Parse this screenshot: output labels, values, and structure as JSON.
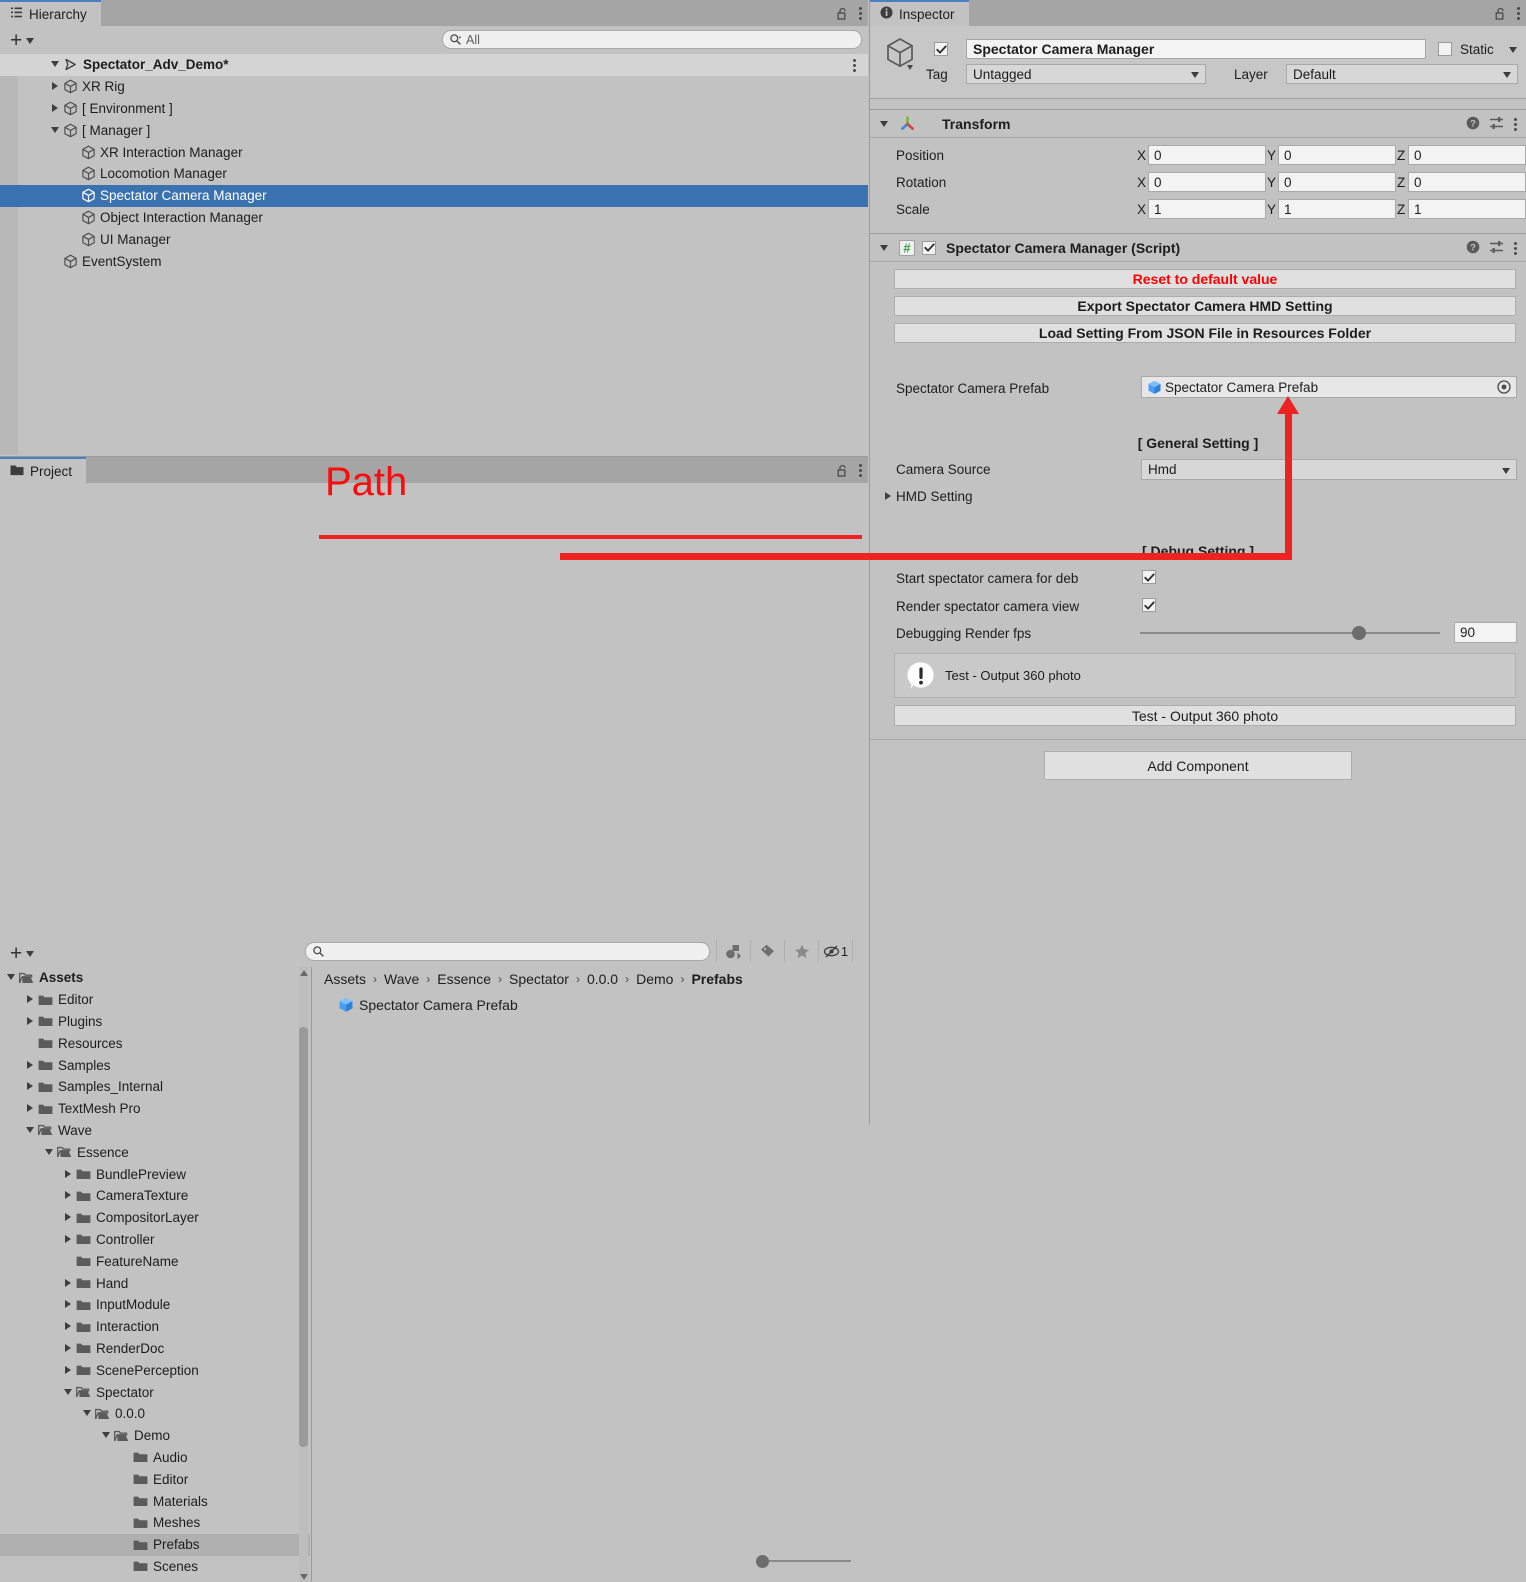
{
  "hierarchy": {
    "tab_label": "Hierarchy",
    "tab_icon": "hierarchy-icon",
    "add_button": "+",
    "search": {
      "placeholder": "All",
      "value": "",
      "icon": "search-icon"
    },
    "lock_icon": "lock-open-icon",
    "menu_icon": "kebab-menu-icon",
    "scene_name": "Spectator_Adv_Demo*",
    "items": [
      {
        "label": "XR Rig",
        "depth": 1,
        "foldout": "collapsed",
        "selected": false
      },
      {
        "label": "[ Environment ]",
        "depth": 1,
        "foldout": "collapsed",
        "selected": false
      },
      {
        "label": "[ Manager ]",
        "depth": 1,
        "foldout": "expanded",
        "selected": false
      },
      {
        "label": "XR Interaction Manager",
        "depth": 2,
        "foldout": "none",
        "selected": false
      },
      {
        "label": "Locomotion Manager",
        "depth": 2,
        "foldout": "none",
        "selected": false
      },
      {
        "label": "Spectator Camera Manager",
        "depth": 2,
        "foldout": "none",
        "selected": true
      },
      {
        "label": "Object Interaction Manager",
        "depth": 2,
        "foldout": "none",
        "selected": false
      },
      {
        "label": "UI Manager",
        "depth": 2,
        "foldout": "none",
        "selected": false
      },
      {
        "label": "EventSystem",
        "depth": 1,
        "foldout": "none",
        "selected": false
      }
    ]
  },
  "project": {
    "tab_label": "Project",
    "tab_icon": "folder-icon",
    "add_button": "+",
    "search": {
      "placeholder": "",
      "value": "",
      "icon": "search-icon"
    },
    "lock_icon": "lock-open-icon",
    "menu_icon": "kebab-menu-icon",
    "tools": [
      {
        "name": "asset-type-filter-icon",
        "label": ""
      },
      {
        "name": "label-filter-icon",
        "label": ""
      },
      {
        "name": "favorites-star-icon",
        "label": ""
      },
      {
        "name": "hidden-packages-icon",
        "label": "1"
      }
    ],
    "tree": [
      {
        "label": "Assets",
        "depth": 0,
        "foldout": "expanded",
        "open_folder": true,
        "bold": true,
        "selected": false
      },
      {
        "label": "Editor",
        "depth": 1,
        "foldout": "collapsed",
        "open_folder": false,
        "bold": false,
        "selected": false
      },
      {
        "label": "Plugins",
        "depth": 1,
        "foldout": "collapsed",
        "open_folder": false,
        "bold": false,
        "selected": false
      },
      {
        "label": "Resources",
        "depth": 1,
        "foldout": "none",
        "open_folder": false,
        "bold": false,
        "selected": false
      },
      {
        "label": "Samples",
        "depth": 1,
        "foldout": "collapsed",
        "open_folder": false,
        "bold": false,
        "selected": false
      },
      {
        "label": "Samples_Internal",
        "depth": 1,
        "foldout": "collapsed",
        "open_folder": false,
        "bold": false,
        "selected": false
      },
      {
        "label": "TextMesh Pro",
        "depth": 1,
        "foldout": "collapsed",
        "open_folder": false,
        "bold": false,
        "selected": false
      },
      {
        "label": "Wave",
        "depth": 1,
        "foldout": "expanded",
        "open_folder": true,
        "bold": false,
        "selected": false
      },
      {
        "label": "Essence",
        "depth": 2,
        "foldout": "expanded",
        "open_folder": true,
        "bold": false,
        "selected": false
      },
      {
        "label": "BundlePreview",
        "depth": 3,
        "foldout": "collapsed",
        "open_folder": false,
        "bold": false,
        "selected": false
      },
      {
        "label": "CameraTexture",
        "depth": 3,
        "foldout": "collapsed",
        "open_folder": false,
        "bold": false,
        "selected": false
      },
      {
        "label": "CompositorLayer",
        "depth": 3,
        "foldout": "collapsed",
        "open_folder": false,
        "bold": false,
        "selected": false
      },
      {
        "label": "Controller",
        "depth": 3,
        "foldout": "collapsed",
        "open_folder": false,
        "bold": false,
        "selected": false
      },
      {
        "label": "FeatureName",
        "depth": 3,
        "foldout": "none",
        "open_folder": false,
        "bold": false,
        "selected": false
      },
      {
        "label": "Hand",
        "depth": 3,
        "foldout": "collapsed",
        "open_folder": false,
        "bold": false,
        "selected": false
      },
      {
        "label": "InputModule",
        "depth": 3,
        "foldout": "collapsed",
        "open_folder": false,
        "bold": false,
        "selected": false
      },
      {
        "label": "Interaction",
        "depth": 3,
        "foldout": "collapsed",
        "open_folder": false,
        "bold": false,
        "selected": false
      },
      {
        "label": "RenderDoc",
        "depth": 3,
        "foldout": "collapsed",
        "open_folder": false,
        "bold": false,
        "selected": false
      },
      {
        "label": "ScenePerception",
        "depth": 3,
        "foldout": "collapsed",
        "open_folder": false,
        "bold": false,
        "selected": false
      },
      {
        "label": "Spectator",
        "depth": 3,
        "foldout": "expanded",
        "open_folder": true,
        "bold": false,
        "selected": false
      },
      {
        "label": "0.0.0",
        "depth": 4,
        "foldout": "expanded",
        "open_folder": true,
        "bold": false,
        "selected": false
      },
      {
        "label": "Demo",
        "depth": 5,
        "foldout": "expanded",
        "open_folder": true,
        "bold": false,
        "selected": false
      },
      {
        "label": "Audio",
        "depth": 6,
        "foldout": "none",
        "open_folder": false,
        "bold": false,
        "selected": false
      },
      {
        "label": "Editor",
        "depth": 6,
        "foldout": "none",
        "open_folder": false,
        "bold": false,
        "selected": false
      },
      {
        "label": "Materials",
        "depth": 6,
        "foldout": "none",
        "open_folder": false,
        "bold": false,
        "selected": false
      },
      {
        "label": "Meshes",
        "depth": 6,
        "foldout": "none",
        "open_folder": false,
        "bold": false,
        "selected": false
      },
      {
        "label": "Prefabs",
        "depth": 6,
        "foldout": "none",
        "open_folder": false,
        "bold": false,
        "selected": true
      },
      {
        "label": "Scenes",
        "depth": 6,
        "foldout": "none",
        "open_folder": false,
        "bold": false,
        "selected": false
      }
    ],
    "breadcrumb": [
      "Assets",
      "Wave",
      "Essence",
      "Spectator",
      "0.0.0",
      "Demo",
      "Prefabs"
    ],
    "breadcrumb_separator": "›",
    "assets": [
      {
        "label": "Spectator Camera Prefab",
        "icon": "prefab-cube-icon"
      }
    ],
    "zoom_slider_icon": "thumbnail-size-slider"
  },
  "inspector": {
    "tab_label": "Inspector",
    "tab_icon": "info-icon",
    "lock_icon": "lock-open-icon",
    "menu_icon": "kebab-menu-icon",
    "object": {
      "enabled": true,
      "name": "Spectator Camera Manager",
      "icon": "gameobject-cube-icon",
      "static_label": "Static",
      "static_checked": false,
      "tag_label": "Tag",
      "tag_value": "Untagged",
      "layer_label": "Layer",
      "layer_value": "Default"
    },
    "transform": {
      "title": "Transform",
      "icon": "transform-axis-icon",
      "expanded": true,
      "axis_labels": [
        "X",
        "Y",
        "Z"
      ],
      "rows": [
        {
          "label": "Position",
          "values": [
            "0",
            "0",
            "0"
          ]
        },
        {
          "label": "Rotation",
          "values": [
            "0",
            "0",
            "0"
          ]
        },
        {
          "label": "Scale",
          "values": [
            "1",
            "1",
            "1"
          ]
        }
      ],
      "help_icon": "help-icon",
      "preset_icon": "preset-sliders-icon",
      "menu_icon": "kebab-menu-icon"
    },
    "script_component": {
      "title": "Spectator Camera Manager (Script)",
      "icon": "csharp-script-icon",
      "enabled": true,
      "expanded": true,
      "help_icon": "help-icon",
      "preset_icon": "preset-sliders-icon",
      "menu_icon": "kebab-menu-icon",
      "buttons": [
        {
          "label": "Reset to default value",
          "color": "#ff0000"
        },
        {
          "label": "Export Spectator Camera HMD Setting",
          "color": "#1d1d1d"
        },
        {
          "label": "Load Setting From JSON File in Resources Folder",
          "color": "#1d1d1d"
        }
      ],
      "prefab_field": {
        "label": "Spectator Camera Prefab",
        "value": "Spectator Camera Prefab",
        "icon": "prefab-cube-icon",
        "picker_icon": "object-picker-icon"
      },
      "general_setting_header": "[ General Setting ]",
      "camera_source": {
        "label": "Camera Source",
        "value": "Hmd"
      },
      "hmd_setting": {
        "label": "HMD Setting",
        "foldout": "collapsed"
      },
      "debug_setting_header": "[ Debug Setting ]",
      "checkboxes": [
        {
          "label": "Start spectator camera for deb",
          "checked": true
        },
        {
          "label": "Render spectator camera view",
          "checked": true
        }
      ],
      "slider": {
        "label": "Debugging Render fps",
        "value": "90",
        "percent": 73
      },
      "helpbox": {
        "text": "Test - Output 360 photo",
        "icon": "warning-info-icon"
      },
      "test_button": {
        "label": "Test - Output 360 photo"
      }
    },
    "add_component_button": "Add Component"
  },
  "annotations": {
    "path_label": "Path",
    "accent_color": "#ef2222"
  }
}
